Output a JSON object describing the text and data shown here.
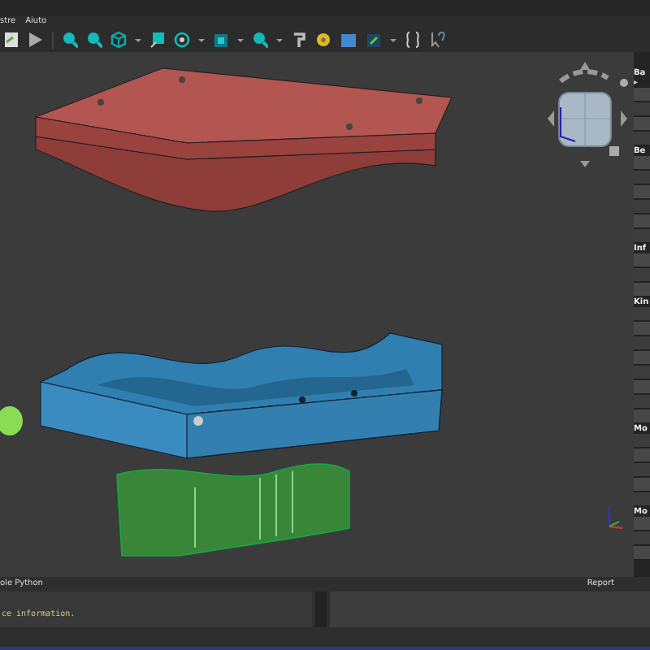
{
  "menu": {
    "items": [
      "stre",
      "Aiuto"
    ]
  },
  "toolbar": {
    "groups": [
      {
        "kind": "doc"
      },
      {
        "kind": "view"
      }
    ]
  },
  "properties": {
    "expander": "▸",
    "sections": [
      "Ba",
      "Be",
      "Inf",
      "Kin",
      "Mo",
      "Mo"
    ]
  },
  "console": {
    "title": "ole Python",
    "text": "ce information."
  },
  "report": {
    "title": "Report"
  }
}
